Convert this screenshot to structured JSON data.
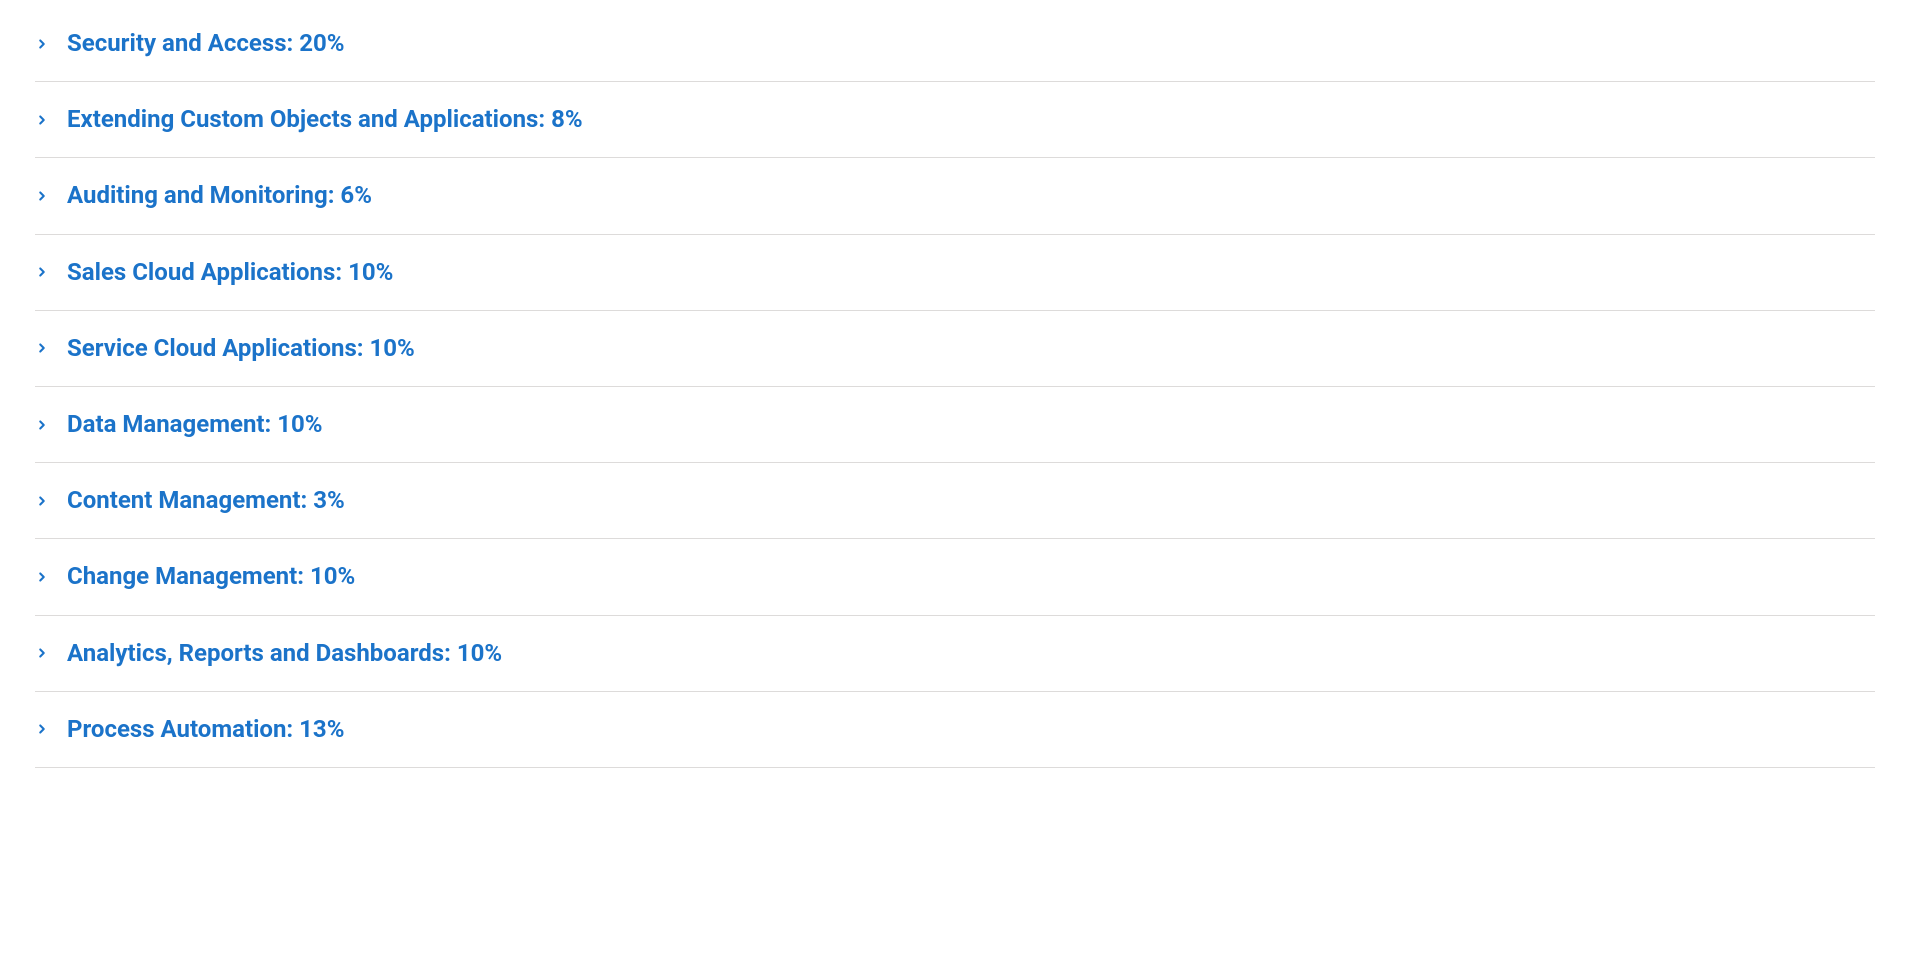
{
  "colors": {
    "link": "#1b73c9",
    "divider": "#dddbda"
  },
  "accordion": {
    "items": [
      {
        "label": "Security and Access: 20%"
      },
      {
        "label": "Extending Custom Objects and Applications: 8%"
      },
      {
        "label": "Auditing and Monitoring: 6%"
      },
      {
        "label": "Sales Cloud Applications: 10%"
      },
      {
        "label": "Service Cloud Applications: 10%"
      },
      {
        "label": "Data Management: 10%"
      },
      {
        "label": "Content Management: 3%"
      },
      {
        "label": "Change Management: 10%"
      },
      {
        "label": "Analytics, Reports and Dashboards: 10%"
      },
      {
        "label": "Process Automation: 13%"
      }
    ]
  }
}
